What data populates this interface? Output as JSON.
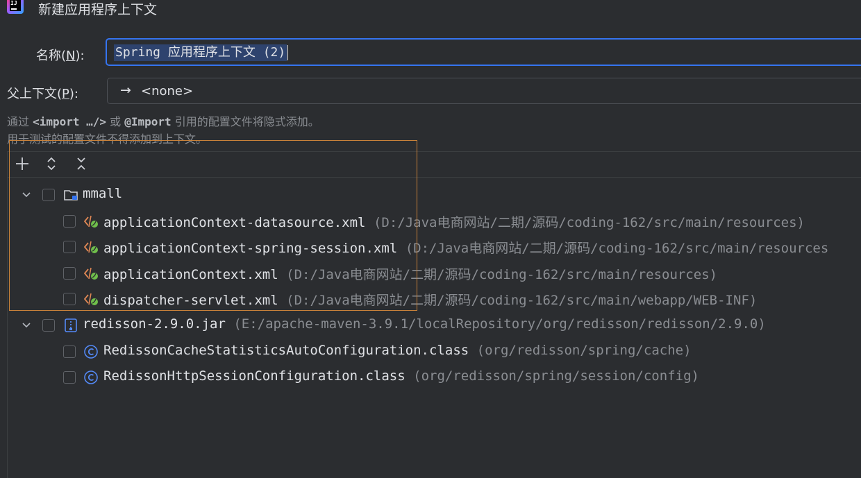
{
  "window": {
    "title": "新建应用程序上下文"
  },
  "form": {
    "name_label_prefix": "名称(",
    "name_mnemonic": "N",
    "name_label_suffix": "):",
    "name_value": "Spring 应用程序上下文 (2)",
    "parent_label_prefix": "父上下文(",
    "parent_mnemonic": "P",
    "parent_label_suffix": "):",
    "parent_arrow": "→",
    "parent_value": "<none>"
  },
  "hints": {
    "line1_a": "通过 ",
    "line1_import_tag": "<import …/>",
    "line1_b": " 或 ",
    "line1_annotation": "@Import",
    "line1_c": " 引用的配置文件将隐式添加。",
    "line2": "用于测试的配置文件不得添加到上下文。"
  },
  "toolbar": {
    "add_icon": "plus-icon",
    "expand_icon": "expand-all-icon",
    "collapse_icon": "collapse-all-icon"
  },
  "tree": [
    {
      "name": "mmall",
      "path": "",
      "icon": "folder-icon",
      "expanded": true,
      "children": [
        {
          "name": "applicationContext-datasource.xml",
          "path": "(D:/Java电商网站/二期/源码/coding-162/src/main/resources)",
          "icon": "spring-xml-icon"
        },
        {
          "name": "applicationContext-spring-session.xml",
          "path": "(D:/Java电商网站/二期/源码/coding-162/src/main/resources",
          "icon": "spring-xml-icon"
        },
        {
          "name": "applicationContext.xml",
          "path": "(D:/Java电商网站/二期/源码/coding-162/src/main/resources)",
          "icon": "spring-xml-icon"
        },
        {
          "name": "dispatcher-servlet.xml",
          "path": "(D:/Java电商网站/二期/源码/coding-162/src/main/webapp/WEB-INF)",
          "icon": "spring-xml-icon"
        }
      ]
    },
    {
      "name": "redisson-2.9.0.jar",
      "path": "(E:/apache-maven-3.9.1/localRepository/org/redisson/redisson/2.9.0)",
      "icon": "jar-icon",
      "expanded": true,
      "children": [
        {
          "name": "RedissonCacheStatisticsAutoConfiguration.class",
          "path": "(org/redisson/spring/cache)",
          "icon": "class-icon"
        },
        {
          "name": "RedissonHttpSessionConfiguration.class",
          "path": "(org/redisson/spring/session/config)",
          "icon": "class-icon"
        }
      ]
    }
  ],
  "colors": {
    "accent": "#3574f0",
    "selection": "#2e436e",
    "highlight_border": "#c9823a",
    "spring_green": "#6fbf4b",
    "xml_orange": "#e08855"
  }
}
